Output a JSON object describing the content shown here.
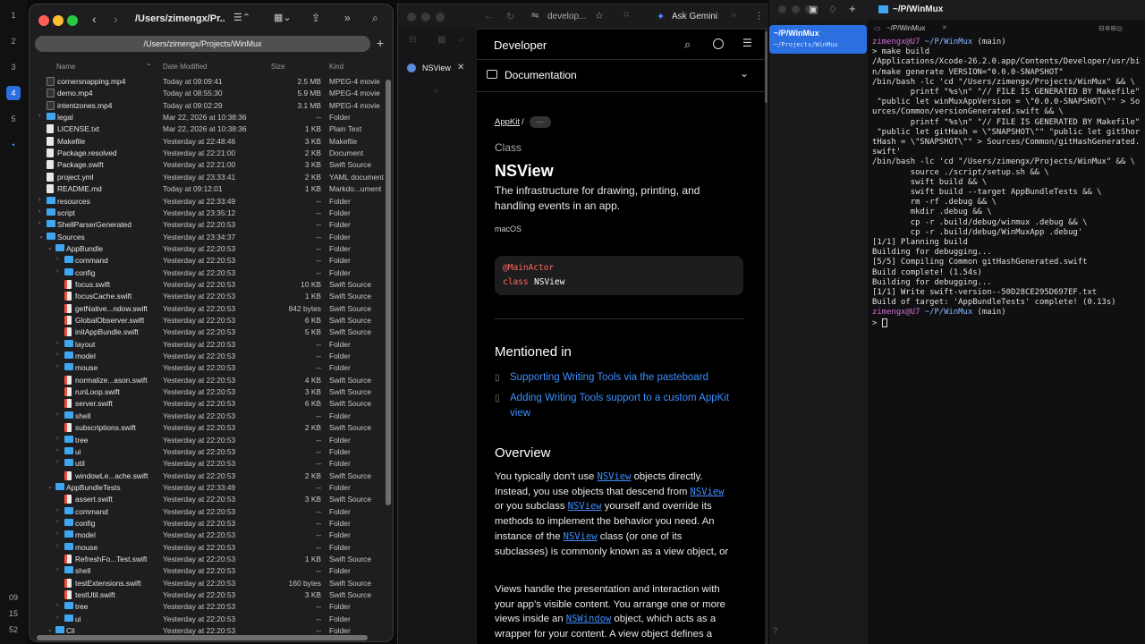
{
  "dock": {
    "items": [
      "1",
      "2",
      "3",
      "4",
      "5",
      "6"
    ],
    "active": "4",
    "bottom": [
      "09",
      "15",
      "52"
    ]
  },
  "finder": {
    "title": "/Users/zimengx/Pr...",
    "path": "/Users/zimengx/Projects/WinMux",
    "columns": {
      "name": "Name",
      "date": "Date Modified",
      "size": "Size",
      "kind": "Kind"
    },
    "rows": [
      {
        "name": "cornersnapping.mp4",
        "date": "Today at 09:09:41",
        "size": "2.5 MB",
        "kind": "MPEG-4 movie",
        "icon": "mp4",
        "indent": 0,
        "chev": ""
      },
      {
        "name": "demo.mp4",
        "date": "Today at 08:55:30",
        "size": "5.9 MB",
        "kind": "MPEG-4 movie",
        "icon": "mp4",
        "indent": 0,
        "chev": ""
      },
      {
        "name": "intentzones.mp4",
        "date": "Today at 09:02:29",
        "size": "3.1 MB",
        "kind": "MPEG-4 movie",
        "icon": "mp4",
        "indent": 0,
        "chev": ""
      },
      {
        "name": "legal",
        "date": "Mar 22, 2026 at 10:38:36",
        "size": "--",
        "kind": "Folder",
        "icon": "folder",
        "indent": 0,
        "chev": "›"
      },
      {
        "name": "LICENSE.txt",
        "date": "Mar 22, 2026 at 10:38:36",
        "size": "1 KB",
        "kind": "Plain Text",
        "icon": "file",
        "indent": 0,
        "chev": ""
      },
      {
        "name": "Makefile",
        "date": "Yesterday at 22:48:46",
        "size": "3 KB",
        "kind": "Makefile",
        "icon": "file",
        "indent": 0,
        "chev": ""
      },
      {
        "name": "Package.resolved",
        "date": "Yesterday at 22:21:00",
        "size": "2 KB",
        "kind": "Document",
        "icon": "file",
        "indent": 0,
        "chev": ""
      },
      {
        "name": "Package.swift",
        "date": "Yesterday at 22:21:00",
        "size": "3 KB",
        "kind": "Swift Source",
        "icon": "file",
        "indent": 0,
        "chev": ""
      },
      {
        "name": "project.yml",
        "date": "Yesterday at 23:33:41",
        "size": "2 KB",
        "kind": "YAML document",
        "icon": "file",
        "indent": 0,
        "chev": ""
      },
      {
        "name": "README.md",
        "date": "Today at 09:12:01",
        "size": "1 KB",
        "kind": "Markdo...ument",
        "icon": "file",
        "indent": 0,
        "chev": ""
      },
      {
        "name": "resources",
        "date": "Yesterday at 22:33:49",
        "size": "--",
        "kind": "Folder",
        "icon": "folder",
        "indent": 0,
        "chev": "›"
      },
      {
        "name": "script",
        "date": "Yesterday at 23:35:12",
        "size": "--",
        "kind": "Folder",
        "icon": "folder",
        "indent": 0,
        "chev": "›"
      },
      {
        "name": "ShellParserGenerated",
        "date": "Yesterday at 22:20:53",
        "size": "--",
        "kind": "Folder",
        "icon": "folder",
        "indent": 0,
        "chev": "›"
      },
      {
        "name": "Sources",
        "date": "Yesterday at 23:34:37",
        "size": "--",
        "kind": "Folder",
        "icon": "folder",
        "indent": 0,
        "chev": "⌄"
      },
      {
        "name": "AppBundle",
        "date": "Yesterday at 22:20:53",
        "size": "--",
        "kind": "Folder",
        "icon": "folder",
        "indent": 1,
        "chev": "⌄"
      },
      {
        "name": "command",
        "date": "Yesterday at 22:20:53",
        "size": "--",
        "kind": "Folder",
        "icon": "folder",
        "indent": 2,
        "chev": "›"
      },
      {
        "name": "config",
        "date": "Yesterday at 22:20:53",
        "size": "--",
        "kind": "Folder",
        "icon": "folder",
        "indent": 2,
        "chev": "›"
      },
      {
        "name": "focus.swift",
        "date": "Yesterday at 22:20:53",
        "size": "10 KB",
        "kind": "Swift Source",
        "icon": "swift",
        "indent": 2,
        "chev": ""
      },
      {
        "name": "focusCache.swift",
        "date": "Yesterday at 22:20:53",
        "size": "1 KB",
        "kind": "Swift Source",
        "icon": "swift",
        "indent": 2,
        "chev": ""
      },
      {
        "name": "getNative...ndow.swift",
        "date": "Yesterday at 22:20:53",
        "size": "842 bytes",
        "kind": "Swift Source",
        "icon": "swift",
        "indent": 2,
        "chev": ""
      },
      {
        "name": "GlobalObserver.swift",
        "date": "Yesterday at 22:20:53",
        "size": "6 KB",
        "kind": "Swift Source",
        "icon": "swift",
        "indent": 2,
        "chev": ""
      },
      {
        "name": "initAppBundle.swift",
        "date": "Yesterday at 22:20:53",
        "size": "5 KB",
        "kind": "Swift Source",
        "icon": "swift",
        "indent": 2,
        "chev": ""
      },
      {
        "name": "layout",
        "date": "Yesterday at 22:20:53",
        "size": "--",
        "kind": "Folder",
        "icon": "folder",
        "indent": 2,
        "chev": "›"
      },
      {
        "name": "model",
        "date": "Yesterday at 22:20:53",
        "size": "--",
        "kind": "Folder",
        "icon": "folder",
        "indent": 2,
        "chev": "›"
      },
      {
        "name": "mouse",
        "date": "Yesterday at 22:20:53",
        "size": "--",
        "kind": "Folder",
        "icon": "folder",
        "indent": 2,
        "chev": "›"
      },
      {
        "name": "normalize...ason.swift",
        "date": "Yesterday at 22:20:53",
        "size": "4 KB",
        "kind": "Swift Source",
        "icon": "swift",
        "indent": 2,
        "chev": ""
      },
      {
        "name": "runLoop.swift",
        "date": "Yesterday at 22:20:53",
        "size": "3 KB",
        "kind": "Swift Source",
        "icon": "swift",
        "indent": 2,
        "chev": ""
      },
      {
        "name": "server.swift",
        "date": "Yesterday at 22:20:53",
        "size": "6 KB",
        "kind": "Swift Source",
        "icon": "swift",
        "indent": 2,
        "chev": ""
      },
      {
        "name": "shell",
        "date": "Yesterday at 22:20:53",
        "size": "--",
        "kind": "Folder",
        "icon": "folder",
        "indent": 2,
        "chev": "›"
      },
      {
        "name": "subscriptions.swift",
        "date": "Yesterday at 22:20:53",
        "size": "2 KB",
        "kind": "Swift Source",
        "icon": "swift",
        "indent": 2,
        "chev": ""
      },
      {
        "name": "tree",
        "date": "Yesterday at 22:20:53",
        "size": "--",
        "kind": "Folder",
        "icon": "folder",
        "indent": 2,
        "chev": "›"
      },
      {
        "name": "ui",
        "date": "Yesterday at 22:20:53",
        "size": "--",
        "kind": "Folder",
        "icon": "folder",
        "indent": 2,
        "chev": "›"
      },
      {
        "name": "util",
        "date": "Yesterday at 22:20:53",
        "size": "--",
        "kind": "Folder",
        "icon": "folder",
        "indent": 2,
        "chev": "›"
      },
      {
        "name": "windowLe...ache.swift",
        "date": "Yesterday at 22:20:53",
        "size": "2 KB",
        "kind": "Swift Source",
        "icon": "swift",
        "indent": 2,
        "chev": ""
      },
      {
        "name": "AppBundleTests",
        "date": "Yesterday at 22:33:49",
        "size": "--",
        "kind": "Folder",
        "icon": "folder",
        "indent": 1,
        "chev": "⌄"
      },
      {
        "name": "assert.swift",
        "date": "Yesterday at 22:20:53",
        "size": "3 KB",
        "kind": "Swift Source",
        "icon": "swift",
        "indent": 2,
        "chev": ""
      },
      {
        "name": "command",
        "date": "Yesterday at 22:20:53",
        "size": "--",
        "kind": "Folder",
        "icon": "folder",
        "indent": 2,
        "chev": "›"
      },
      {
        "name": "config",
        "date": "Yesterday at 22:20:53",
        "size": "--",
        "kind": "Folder",
        "icon": "folder",
        "indent": 2,
        "chev": "›"
      },
      {
        "name": "model",
        "date": "Yesterday at 22:20:53",
        "size": "--",
        "kind": "Folder",
        "icon": "folder",
        "indent": 2,
        "chev": "›"
      },
      {
        "name": "mouse",
        "date": "Yesterday at 22:20:53",
        "size": "--",
        "kind": "Folder",
        "icon": "folder",
        "indent": 2,
        "chev": "›"
      },
      {
        "name": "RefreshFo...Test.swift",
        "date": "Yesterday at 22:20:53",
        "size": "1 KB",
        "kind": "Swift Source",
        "icon": "swift",
        "indent": 2,
        "chev": ""
      },
      {
        "name": "shell",
        "date": "Yesterday at 22:20:53",
        "size": "--",
        "kind": "Folder",
        "icon": "folder",
        "indent": 2,
        "chev": "›"
      },
      {
        "name": "testExtensions.swift",
        "date": "Yesterday at 22:20:53",
        "size": "160 bytes",
        "kind": "Swift Source",
        "icon": "swift",
        "indent": 2,
        "chev": ""
      },
      {
        "name": "testUtil.swift",
        "date": "Yesterday at 22:20:53",
        "size": "3 KB",
        "kind": "Swift Source",
        "icon": "swift",
        "indent": 2,
        "chev": ""
      },
      {
        "name": "tree",
        "date": "Yesterday at 22:20:53",
        "size": "--",
        "kind": "Folder",
        "icon": "folder",
        "indent": 2,
        "chev": "›"
      },
      {
        "name": "ui",
        "date": "Yesterday at 22:20:53",
        "size": "--",
        "kind": "Folder",
        "icon": "folder",
        "indent": 2,
        "chev": "›"
      },
      {
        "name": "Cli",
        "date": "Yesterday at 22:20:53",
        "size": "--",
        "kind": "Folder",
        "icon": "folder",
        "indent": 1,
        "chev": "⌄"
      }
    ]
  },
  "browser": {
    "address": "develop...",
    "ask": "Ask Gemini",
    "tab": "NSView",
    "brand": "Developer",
    "section": "Documentation",
    "breadcrumb": "AppKit",
    "breadcrumb_sep": "/",
    "more": "···",
    "kind": "Class",
    "title": "NSView",
    "summary1": "The infrastructure for drawing, printing, and",
    "summary2": "handling events in an app.",
    "platform": "macOS",
    "code_attr": "@MainActor",
    "code_kw": "class",
    "code_name": "NSView",
    "mentioned": "Mentioned in",
    "m1": "Supporting Writing Tools via the pasteboard",
    "m2a": "Adding Writing Tools support to a custom AppKit",
    "m2b": "view",
    "overview": "Overview",
    "p1": [
      "You typically don’t use ",
      "NSView",
      " objects directly.",
      "Instead, you use objects that descend from ",
      "NSView",
      "or you subclass ",
      "NSView",
      " yourself and override its",
      "methods to implement the behavior you need. An",
      "instance of the ",
      "NSView",
      " class (or one of its",
      "subclasses) is commonly known as a view object, or",
      "simply as a view."
    ],
    "p2": [
      "Views handle the presentation and interaction with",
      "your app’s visible content. You arrange one or more",
      "views inside an ",
      "NSWindow",
      " object, which acts as a",
      "wrapper for your content. A view object defines a"
    ]
  },
  "terminal": {
    "tab": "~/P/WinMux",
    "side_title": "~/P/WinMux",
    "side_path": "~/Projects/WinMux",
    "subtab": "~/P/WinMux",
    "lines": [
      {
        "t": "prompt",
        "a": "zimengx@U7 ",
        "b": "~/P/WinMux",
        " c": " (main)"
      },
      {
        "t": "text",
        "v": "> make build"
      },
      {
        "t": "text",
        "v": "/Applications/Xcode-26.2.0.app/Contents/Developer/usr/bi"
      },
      {
        "t": "text",
        "v": "n/make generate VERSION=\"0.0.0-SNAPSHOT\""
      },
      {
        "t": "text",
        "v": "/bin/bash -lc 'cd \"/Users/zimengx/Projects/WinMux\" && \\"
      },
      {
        "t": "text",
        "v": "        printf \"%s\\n\" \"// FILE IS GENERATED BY Makefile\""
      },
      {
        "t": "text",
        "v": " \"public let winMuxAppVersion = \\\"0.0.0-SNAPSHOT\\\"\" > So"
      },
      {
        "t": "text",
        "v": "urces/Common/versionGenerated.swift && \\"
      },
      {
        "t": "text",
        "v": "        printf \"%s\\n\" \"// FILE IS GENERATED BY Makefile\""
      },
      {
        "t": "text",
        "v": " \"public let gitHash = \\\"SNAPSHOT\\\"\" \"public let gitShor"
      },
      {
        "t": "text",
        "v": "tHash = \\\"SNAPSHOT\\\"\" > Sources/Common/gitHashGenerated."
      },
      {
        "t": "text",
        "v": "swift'"
      },
      {
        "t": "text",
        "v": "/bin/bash -lc 'cd \"/Users/zimengx/Projects/WinMux\" && \\"
      },
      {
        "t": "text",
        "v": "        source ./script/setup.sh && \\"
      },
      {
        "t": "text",
        "v": "        swift build && \\"
      },
      {
        "t": "text",
        "v": "        swift build --target AppBundleTests && \\"
      },
      {
        "t": "text",
        "v": "        rm -rf .debug && \\"
      },
      {
        "t": "text",
        "v": "        mkdir .debug && \\"
      },
      {
        "t": "text",
        "v": "        cp -r .build/debug/winmux .debug && \\"
      },
      {
        "t": "text",
        "v": "        cp -r .build/debug/WinMuxApp .debug'"
      },
      {
        "t": "text",
        "v": "[1/1] Planning build"
      },
      {
        "t": "text",
        "v": "Building for debugging..."
      },
      {
        "t": "text",
        "v": "[5/5] Compiling Common gitHashGenerated.swift"
      },
      {
        "t": "text",
        "v": "Build complete! (1.54s)"
      },
      {
        "t": "text",
        "v": "Building for debugging..."
      },
      {
        "t": "text",
        "v": "[1/1] Write swift-version--50D28CE295D697EF.txt"
      },
      {
        "t": "text",
        "v": "Build of target: 'AppBundleTests' complete! (0.13s)"
      },
      {
        "t": "prompt",
        "a": "zimengx@U7 ",
        "b": "~/P/WinMux",
        "c": " (main)"
      },
      {
        "t": "text",
        "v": "> "
      }
    ]
  }
}
